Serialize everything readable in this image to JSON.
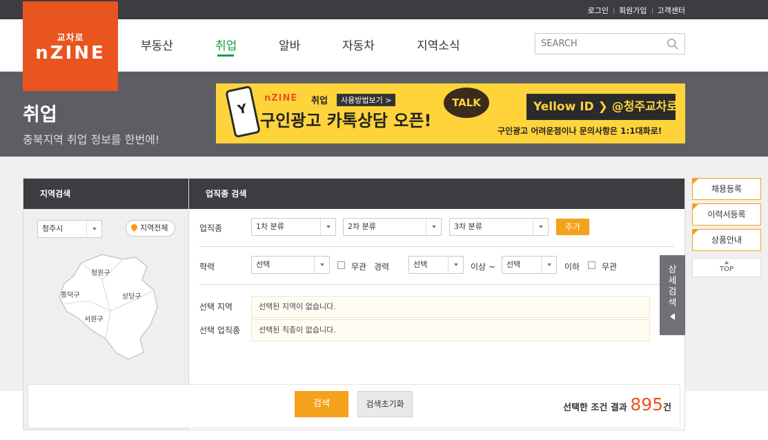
{
  "top_links": [
    "로그인",
    "회원가입",
    "고객센터"
  ],
  "logo": {
    "sub": "교차로",
    "main": "nZINE"
  },
  "nav": [
    {
      "label": "부동산"
    },
    {
      "label": "취업",
      "active": true
    },
    {
      "label": "알바"
    },
    {
      "label": "자동차"
    },
    {
      "label": "지역소식"
    }
  ],
  "search": {
    "placeholder": "SEARCH"
  },
  "hero": {
    "title": "취업",
    "subtitle": "충북지역 취업 정보를 한번에!"
  },
  "banner": {
    "brand": "nZINE",
    "brand_suffix": "취업",
    "howto": "사용방법보기 >",
    "headline": "구인광고 카톡상담 오픈!",
    "talk": "TALK",
    "yellow_id": "Yellow ID ❯ @청주교차로",
    "note": "구인광고 어려운점이나 문의사항은 1:1대화로!"
  },
  "region_panel": {
    "title": "지역검색",
    "city": "청주시",
    "all_button": "지역전체",
    "districts": [
      "청원구",
      "흥덕구",
      "상당구",
      "서원구"
    ]
  },
  "job_panel": {
    "title": "업직종 검색",
    "job_label": "업직종",
    "cat1": "1차 분류",
    "cat2": "2차 분류",
    "cat3": "3차 분류",
    "add": "추가",
    "edu_label": "학력",
    "edu_value": "선택",
    "edu_any": "무관",
    "career_label": "경력",
    "career_from": "선택",
    "career_over": "이상 ~",
    "career_to": "선택",
    "career_under": "이하",
    "career_any": "무관",
    "sel_region_label": "선택 지역",
    "sel_region_value": "선택된 지역이 없습니다.",
    "sel_job_label": "선택 업직종",
    "sel_job_value": "선택된 직종이 없습니다.",
    "detail": "상세검색"
  },
  "footer": {
    "search": "검색",
    "reset": "검색초기화",
    "result_prefix": "선택한 조건 결과",
    "result_count": "895",
    "result_suffix": "건"
  },
  "side_menu": [
    "채용등록",
    "이력서등록",
    "상품안내"
  ],
  "top_button": "TOP",
  "colors": {
    "brand": "#e9541f",
    "accent": "#f4a11b",
    "nav_active": "#1b9b4a"
  }
}
